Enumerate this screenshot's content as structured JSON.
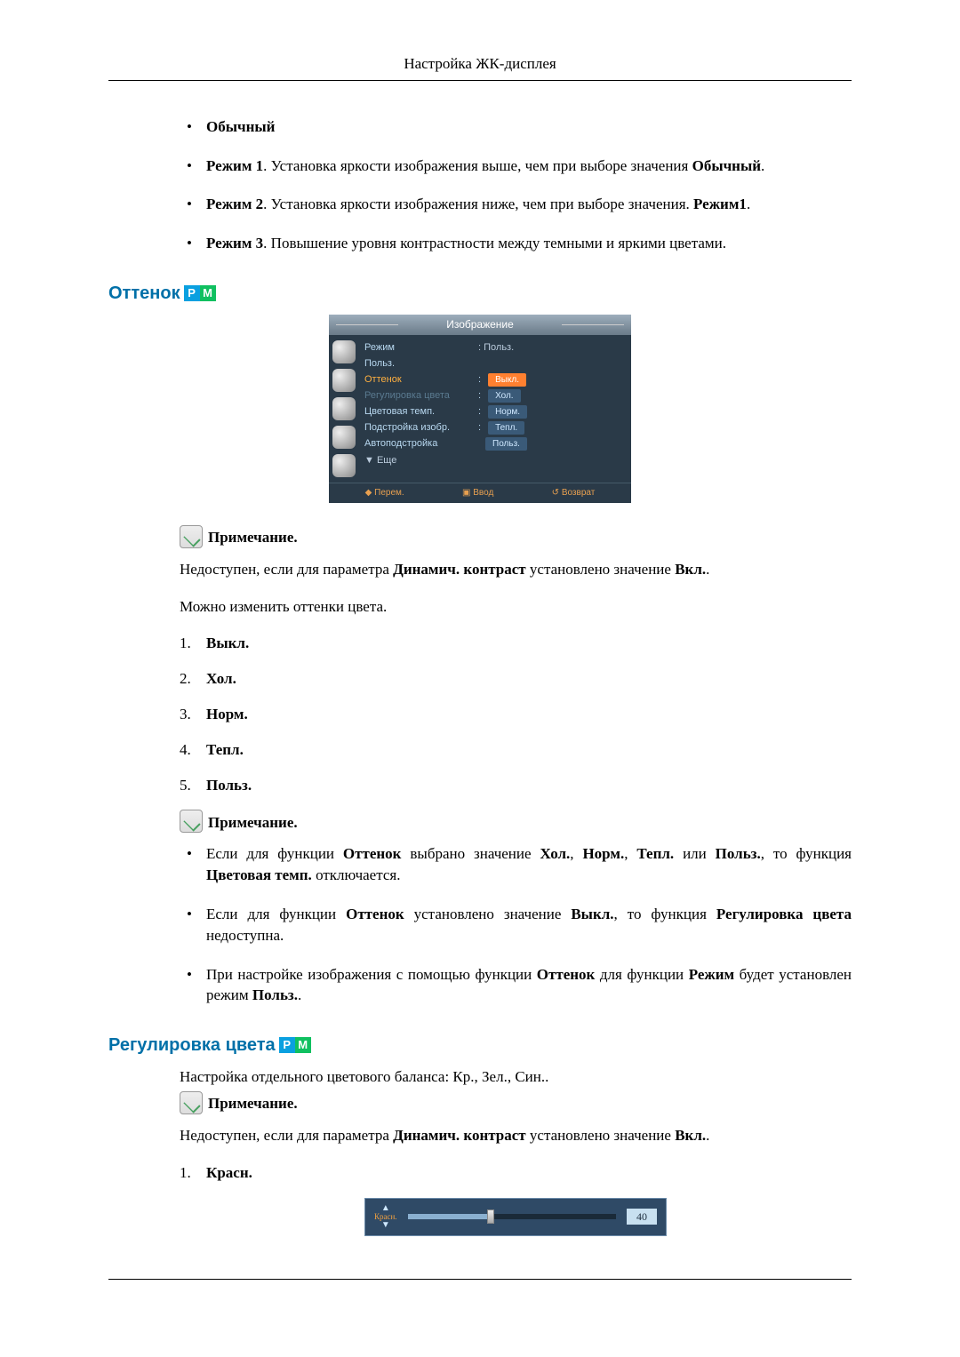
{
  "header": {
    "title": "Настройка ЖК-дисплея"
  },
  "modes": {
    "items": [
      {
        "strong": "Обычный"
      },
      {
        "prefix_strong": "Режим 1",
        "text": ". Установка яркости изображения выше, чем при выборе значения ",
        "suffix_strong": "Обычный",
        "tail": "."
      },
      {
        "prefix_strong": "Режим 2",
        "text": ". Установка яркости изображения ниже, чем при выборе значения. ",
        "suffix_strong": "Режим1",
        "tail": "."
      },
      {
        "prefix_strong": "Режим 3",
        "text": ". Повышение уровня контрастности между темными и яркими цветами.",
        "suffix_strong": "",
        "tail": ""
      }
    ]
  },
  "section_tone": {
    "title": "Оттенок",
    "badges": {
      "p": "P",
      "m": "M"
    },
    "osd": {
      "title": "Изображение",
      "rows": {
        "mode_label": "Режим",
        "mode_value": ": Польз.",
        "custom_label": "Польз.",
        "tone_label": "Оттенок",
        "coloradj_label": "Регулировка цвета",
        "colortemp_label": "Цветовая темп.",
        "imageadj_label": "Подстройка изобр.",
        "autoadj_label": "Автоподстройка",
        "more_label": "▼ Еще",
        "opts": {
          "off": "Выкл.",
          "cold": "Хол.",
          "norm": "Норм.",
          "warm": "Тепл.",
          "custom": "Польз."
        }
      },
      "footer": {
        "move": "Перем.",
        "enter": "Ввод",
        "back": "Возврат"
      }
    },
    "note1_label": "Примечание.",
    "note1_text_pre": "Недоступен, если для параметра ",
    "note1_text_s1": "Динамич. контраст",
    "note1_text_mid": " установлено значение ",
    "note1_text_s2": "Вкл.",
    "note1_text_post": ".",
    "desc": "Можно изменить оттенки цвета.",
    "list": {
      "i1": "Выкл.",
      "i2": "Хол.",
      "i3": "Норм.",
      "i4": "Тепл.",
      "i5": "Польз."
    },
    "note2_label": "Примечание.",
    "note2_bullets": {
      "b1_pre": "Если для функции ",
      "b1_s1": "Оттенок",
      "b1_mid1": " выбрано значение ",
      "b1_s2": "Хол.",
      "b1_c1": ", ",
      "b1_s3": "Норм.",
      "b1_c2": ", ",
      "b1_s4": "Тепл.",
      "b1_mid2": " или ",
      "b1_s5": "Польз.",
      "b1_mid3": ", то функция ",
      "b1_s6": "Цветовая темп.",
      "b1_post": " отключается.",
      "b2_pre": "Если для функции ",
      "b2_s1": "Оттенок",
      "b2_mid1": " установлено значение ",
      "b2_s2": "Выкл.",
      "b2_mid2": ", то функция ",
      "b2_s3": "Регулировка цвета",
      "b2_post": " недоступна.",
      "b3_pre": "При настройке изображения с помощью функции ",
      "b3_s1": "Оттенок",
      "b3_mid1": " для функции ",
      "b3_s2": "Режим",
      "b3_mid2": " будет установлен режим ",
      "b3_s3": "Польз.",
      "b3_post": "."
    }
  },
  "section_color": {
    "title": "Регулировка цвета",
    "badges": {
      "p": "P",
      "m": "M"
    },
    "desc": "Настройка отдельного цветового баланса: Кр., Зел., Син..",
    "note_label": "Примечание.",
    "note_text_pre": "Недоступен, если для параметра ",
    "note_text_s1": "Динамич. контраст",
    "note_text_mid": " установлено значение ",
    "note_text_s2": "Вкл.",
    "note_text_post": ".",
    "list": {
      "i1": "Красн."
    },
    "slider": {
      "label": "Красн.",
      "value": "40",
      "percent": 40
    }
  }
}
